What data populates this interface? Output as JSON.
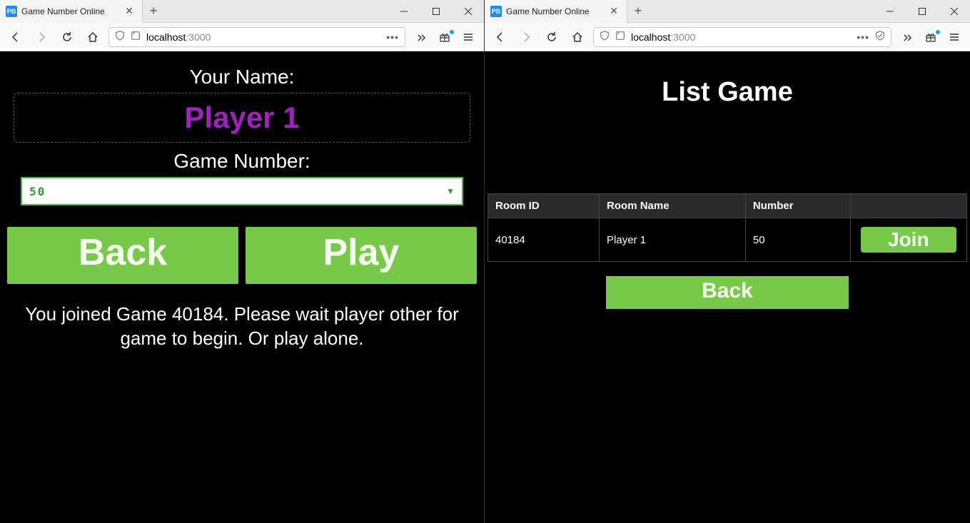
{
  "leftWindow": {
    "tabTitle": "Game Number Online",
    "favicon": "PB",
    "url": {
      "host": "localhost",
      "port": ":3000"
    },
    "form": {
      "nameLabel": "Your Name:",
      "nameValue": "Player 1",
      "numberLabel": "Game Number:",
      "numberValue": "50",
      "backLabel": "Back",
      "playLabel": "Play",
      "statusMessage": "You joined Game 40184. Please wait player other for game to begin. Or play alone."
    }
  },
  "rightWindow": {
    "tabTitle": "Game Number Online",
    "favicon": "PB",
    "url": {
      "host": "localhost",
      "port": ":3000"
    },
    "list": {
      "title": "List Game",
      "columns": {
        "roomId": "Room ID",
        "roomName": "Room Name",
        "number": "Number"
      },
      "rows": [
        {
          "roomId": "40184",
          "roomName": "Player 1",
          "number": "50",
          "joinLabel": "Join"
        }
      ],
      "backLabel": "Back"
    }
  }
}
